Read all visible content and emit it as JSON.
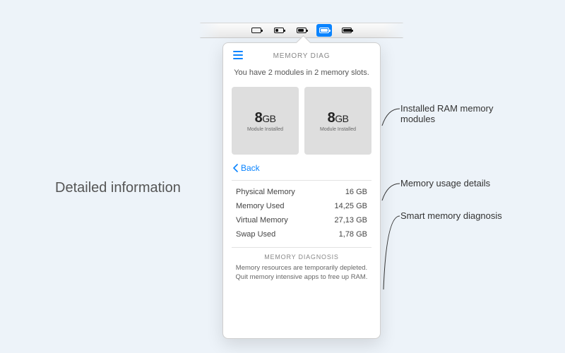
{
  "left_caption": "Detailed information",
  "menubar": {
    "item_count": 5,
    "active_index": 3,
    "fills": [
      0,
      0.33,
      0.66,
      0.85,
      1.0
    ]
  },
  "popover": {
    "title": "MEMORY DIAG",
    "subtitle": "You have 2 modules in 2 memory slots.",
    "modules": [
      {
        "size_num": "8",
        "size_unit": "GB",
        "sub": "Module Installed"
      },
      {
        "size_num": "8",
        "size_unit": "GB",
        "sub": "Module Installed"
      }
    ],
    "back_label": "Back",
    "stats": [
      {
        "label": "Physical Memory",
        "value": "16 GB"
      },
      {
        "label": "Memory Used",
        "value": "14,25 GB"
      },
      {
        "label": "Virtual Memory",
        "value": "27,13 GB"
      },
      {
        "label": "Swap Used",
        "value": "1,78 GB"
      }
    ],
    "diagnosis_title": "MEMORY DIAGNOSIS",
    "diagnosis_line1": "Memory resources are temporarily depleted.",
    "diagnosis_line2": "Quit memory intensive apps to free up RAM."
  },
  "annotations": {
    "a1": "Installed RAM memory\nmodules",
    "a2": "Memory usage details",
    "a3": "Smart memory diagnosis"
  }
}
